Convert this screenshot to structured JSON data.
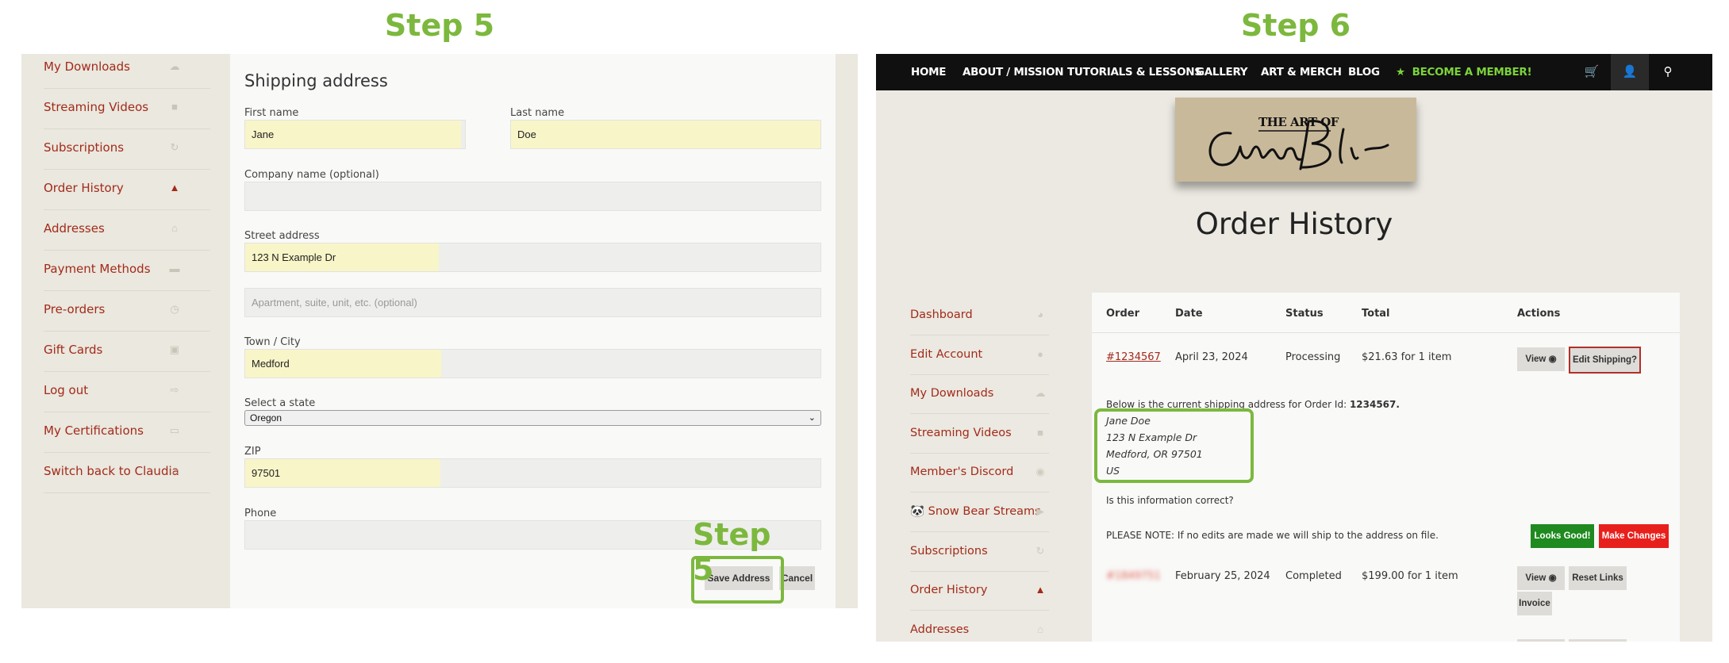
{
  "step_left": "Step 5",
  "step_right": "Step 6",
  "step_inline": "Step 5",
  "left_sidebar": [
    {
      "label": "My Downloads",
      "icon": "cloud-download-icon"
    },
    {
      "label": "Streaming Videos",
      "icon": "video-camera-icon"
    },
    {
      "label": "Subscriptions",
      "icon": "refresh-icon"
    },
    {
      "label": "Order History",
      "icon": "basket-icon",
      "active": true
    },
    {
      "label": "Addresses",
      "icon": "home-icon"
    },
    {
      "label": "Payment Methods",
      "icon": "credit-card-icon"
    },
    {
      "label": "Pre-orders",
      "icon": "clock-icon"
    },
    {
      "label": "Gift Cards",
      "icon": "gift-icon"
    },
    {
      "label": "Log out",
      "icon": "sign-out-icon"
    },
    {
      "label": "My Certifications",
      "icon": "document-icon"
    },
    {
      "label": "Switch back to Claudia",
      "icon": "document-icon"
    }
  ],
  "form": {
    "title": "Shipping address",
    "first_name_label": "First name",
    "first_name_value": "Jane",
    "last_name_label": "Last name",
    "last_name_value": "Doe",
    "company_label": "Company name (optional)",
    "company_value": "",
    "street_label": "Street address",
    "street_value": "123 N Example Dr",
    "apartment_placeholder": "Apartment, suite, unit, etc. (optional)",
    "city_label": "Town / City",
    "city_value": "Medford",
    "state_label": "Select a state",
    "state_value": "Oregon",
    "zip_label": "ZIP",
    "zip_value": "97501",
    "phone_label": "Phone",
    "phone_value": "",
    "save_button": "Save Address",
    "cancel_button": "Cancel"
  },
  "nav": {
    "items": [
      "HOME",
      "ABOUT / MISSION",
      "TUTORIALS & LESSONS",
      "GALLERY",
      "ART & MERCH",
      "BLOG"
    ],
    "member": "BECOME A MEMBER!",
    "icons": [
      "cart-icon",
      "user-icon",
      "search-icon"
    ]
  },
  "logo": {
    "text": "THE ART OF"
  },
  "page_title": "Order History",
  "right_sidebar": [
    {
      "label": "Dashboard",
      "icon": "gauge-icon"
    },
    {
      "label": "Edit Account",
      "icon": "user-icon"
    },
    {
      "label": "My Downloads",
      "icon": "cloud-download-icon"
    },
    {
      "label": "Streaming Videos",
      "icon": "video-camera-icon"
    },
    {
      "label": "Member's Discord",
      "icon": "discord-icon"
    },
    {
      "label": "🐼 Snow Bear Streams",
      "icon": "play-icon"
    },
    {
      "label": "Subscriptions",
      "icon": "refresh-icon"
    },
    {
      "label": "Order History",
      "icon": "basket-icon",
      "active": true
    },
    {
      "label": "Addresses",
      "icon": "home-icon"
    }
  ],
  "orders": {
    "headers": [
      "Order",
      "Date",
      "Status",
      "Total",
      "Actions"
    ],
    "row1": {
      "order": "#1234567",
      "date": "April 23, 2024",
      "status": "Processing",
      "total": "$21.63 for 1 item",
      "view": "View",
      "edit_shipping": "Edit Shipping?"
    },
    "shipping_note_prefix": "Below is the current shipping address for Order Id: ",
    "shipping_note_id": "1234567.",
    "address": [
      "Jane Doe",
      "123 N Example Dr",
      "Medford, OR 97501",
      "US"
    ],
    "question": "Is this information correct?",
    "looks_good": "Looks Good!",
    "make_changes": "Make Changes",
    "please_note": "PLEASE NOTE: If no edits are made we will ship to the address on file.",
    "row2": {
      "order": "#1849751",
      "date": "February 25, 2024",
      "status": "Completed",
      "total": "$199.00 for 1 item",
      "view": "View",
      "reset_links": "Reset Links",
      "invoice": "Invoice"
    }
  },
  "colors": {
    "accent_green": "#7cb83d",
    "link_red": "#a32a1a",
    "looks_good": "#1f8a1f",
    "make_changes": "#e8201c",
    "edit_border": "#b0302a"
  }
}
